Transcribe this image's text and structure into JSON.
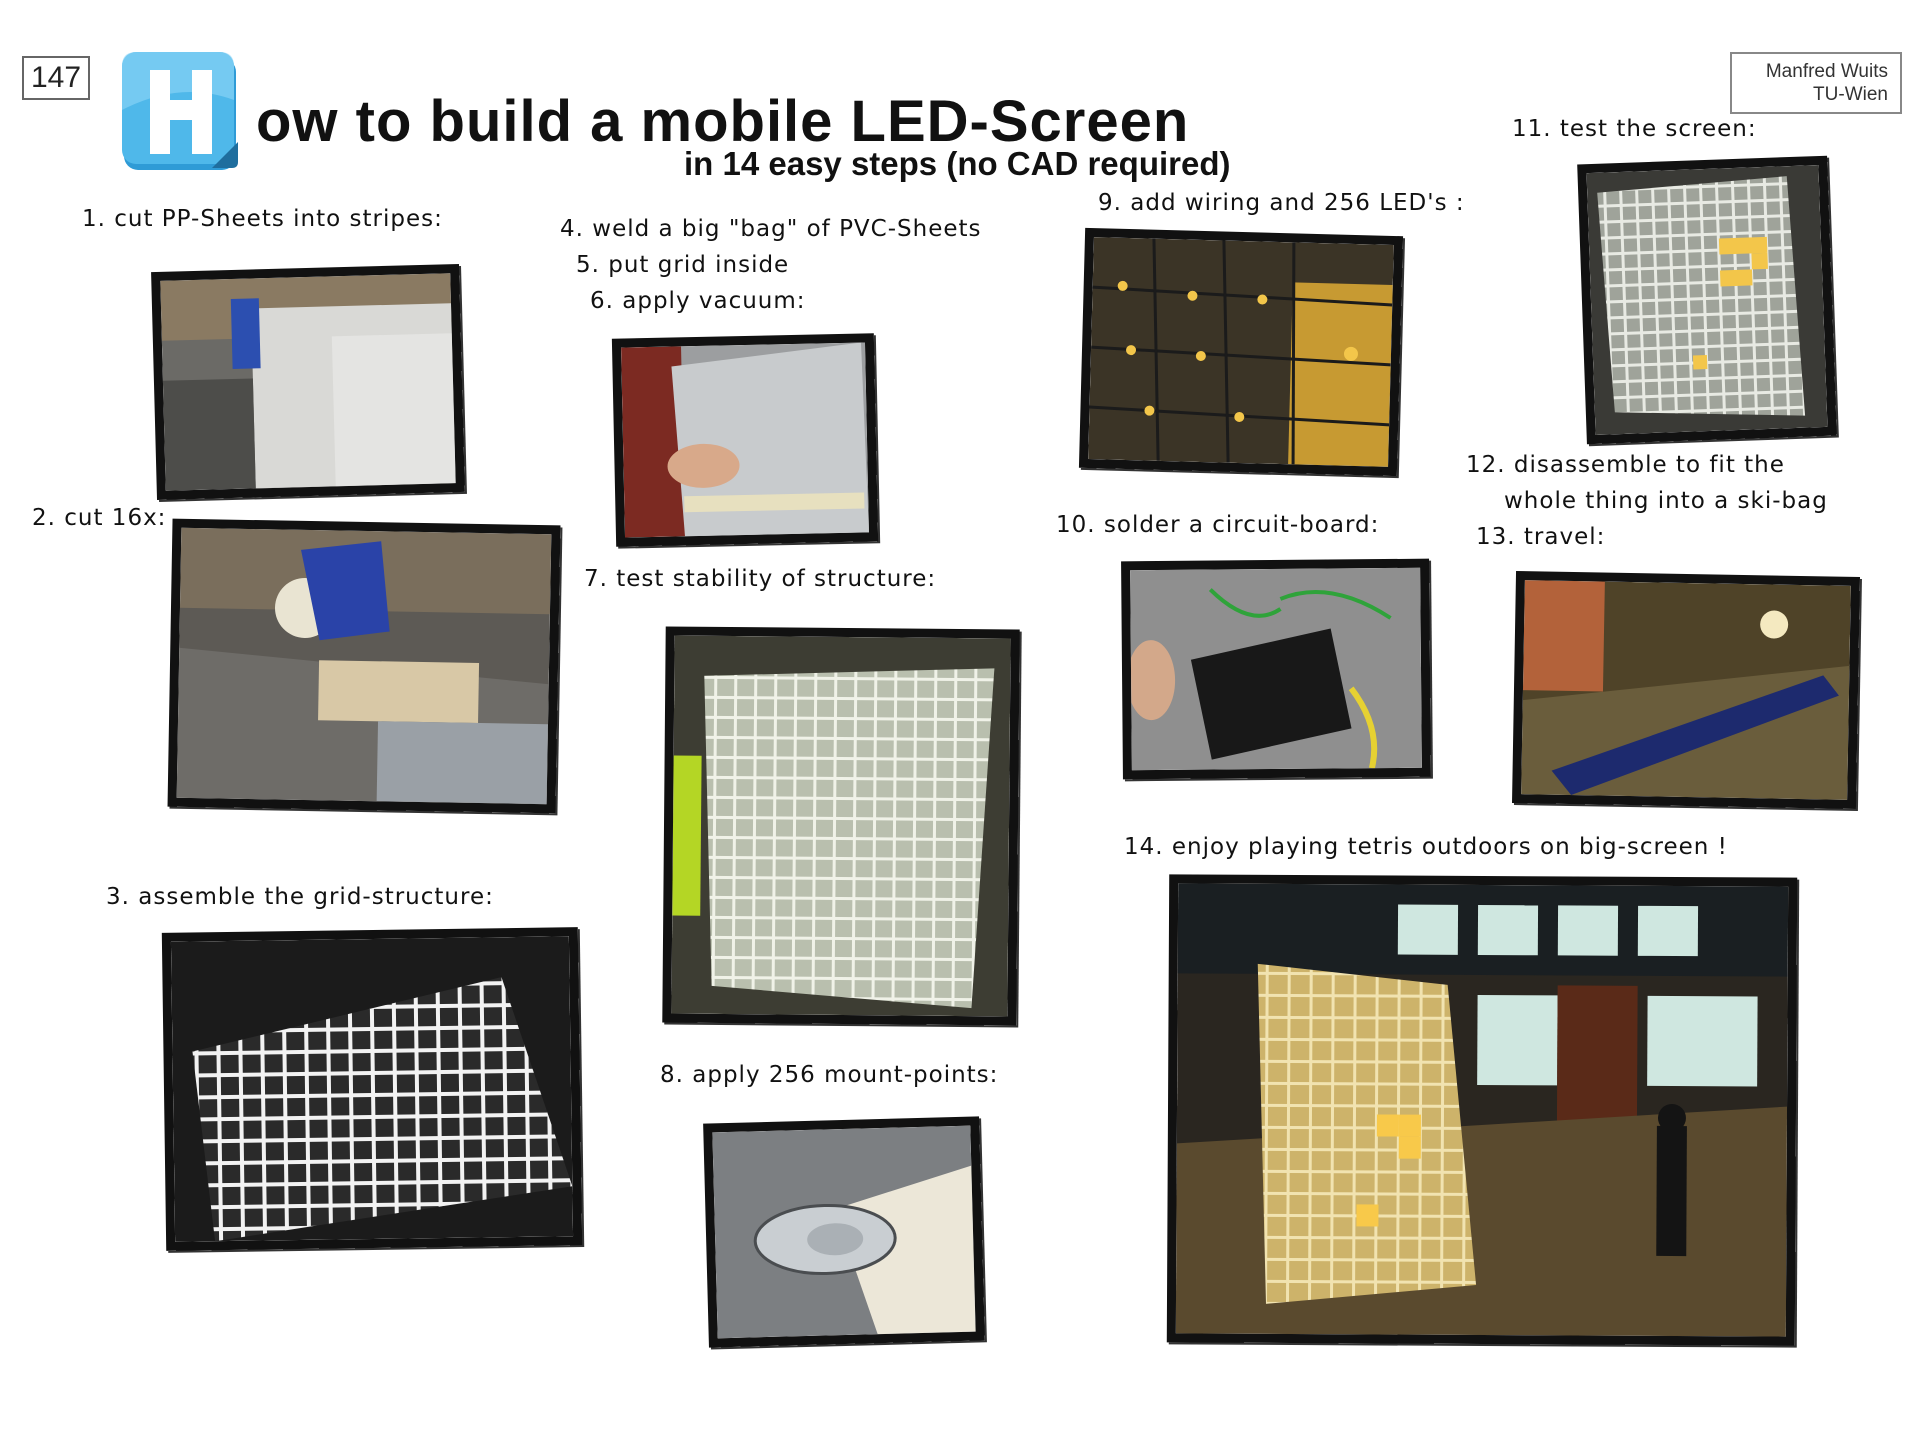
{
  "page_number": "147",
  "author": {
    "name": "Manfred Wuits",
    "institution": "TU-Wien"
  },
  "logo_icon": "h-letter-icon",
  "title": "ow to build a mobile LED-Screen",
  "subtitle": "in 14 easy steps (no CAD required)",
  "steps": [
    "1. cut PP-Sheets into stripes:",
    "2. cut 16x:",
    "3. assemble the grid-structure:",
    "4. weld a big \"bag\" of PVC-Sheets",
    "5. put grid inside",
    "6. apply vacuum:",
    "7. test stability of structure:",
    "8. apply 256 mount-points:",
    "9. add wiring and 256 LED's :",
    "10. solder a circuit-board:",
    "11. test the screen:",
    "12. disassemble to fit the",
    "whole thing into a ski-bag",
    "13. travel:",
    "14. enjoy playing tetris outdoors on big-screen !"
  ],
  "colors": {
    "logo": "#3aa9e0",
    "ink": "#111111",
    "led": "#f3c64a"
  }
}
